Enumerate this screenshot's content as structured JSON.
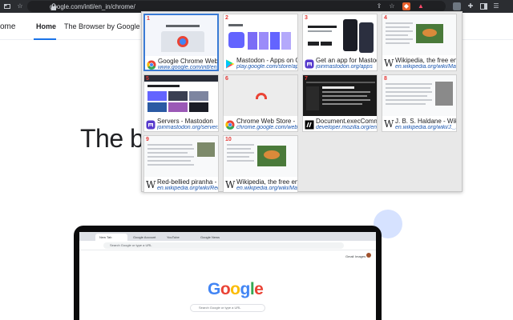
{
  "browser": {
    "url": "google.com/intl/en_in/chrome/",
    "colors": {
      "toolbar_bg": "#2b2d31",
      "urlbar_bg": "#1f2023"
    },
    "icons": [
      "tab-search-icon",
      "lock-icon",
      "share-icon",
      "bookmark-star-icon",
      "brave-shield-icon",
      "brave-rewards-icon",
      "extension-icon",
      "puzzle-icon",
      "sidebar-icon",
      "menu-icon"
    ]
  },
  "site": {
    "logo_partial": "ome",
    "nav": [
      {
        "label": "Home",
        "active": true
      },
      {
        "label": "The Browser by Google",
        "active": false
      }
    ],
    "hero_partial": "The br",
    "accent": "#1a73e8"
  },
  "laptop_screen": {
    "tabs": [
      "New Tab",
      "Google Account",
      "YouTube",
      "Google News"
    ],
    "omnibox_placeholder": "Search Google or type a URL",
    "top_links": [
      "Gmail",
      "Images"
    ],
    "logo": [
      "G",
      "o",
      "o",
      "g",
      "l",
      "e"
    ],
    "logo_colors": [
      "#4285f4",
      "#ea4335",
      "#fbbc05",
      "#4285f4",
      "#34a853",
      "#ea4335"
    ],
    "search_placeholder": "Search Google or type a URL"
  },
  "tab_grid": {
    "cards": [
      {
        "number": "1",
        "title": "Google Chrome Web Browser",
        "url": "www.google.com/intl/en_in/chrome/",
        "favicon": "chrome-icon",
        "active": true
      },
      {
        "number": "2",
        "title": "Mastodon - Apps on Google Play",
        "url": "play.google.com/store/apps",
        "favicon": "google-play-icon",
        "active": false
      },
      {
        "number": "3",
        "title": "Get an app for Mastodon",
        "url": "joinmastodon.org/apps",
        "favicon": "mastodon-icon",
        "active": false
      },
      {
        "number": "4",
        "title": "Wikipedia, the free encyclopedia",
        "url": "en.wikipedia.org/wiki/Main_Page",
        "favicon": "wikipedia-icon",
        "active": false
      },
      {
        "number": "5",
        "title": "Servers - Mastodon",
        "url": "joinmastodon.org/servers",
        "favicon": "mastodon-icon",
        "active": false
      },
      {
        "number": "6",
        "title": "Chrome Web Store - Extensions",
        "url": "chrome.google.com/webstore",
        "favicon": "chrome-icon",
        "active": false
      },
      {
        "number": "7",
        "title": "Document.execCommand()",
        "url": "developer.mozilla.org/en-US/docs",
        "favicon": "mdn-icon",
        "active": false
      },
      {
        "number": "8",
        "title": "J. B. S. Haldane - Wikipedia",
        "url": "en.wikipedia.org/wiki/J._B._S._Haldane",
        "favicon": "wikipedia-icon",
        "active": false
      },
      {
        "number": "9",
        "title": "Red-bellied piranha - Wikipedia",
        "url": "en.wikipedia.org/wiki/Red-bellied_piranha",
        "favicon": "wikipedia-icon",
        "active": false
      },
      {
        "number": "10",
        "title": "Wikipedia, the free encyclopedia",
        "url": "en.wikipedia.org/wiki/Main_Page",
        "favicon": "wikipedia-icon",
        "active": false
      }
    ]
  }
}
